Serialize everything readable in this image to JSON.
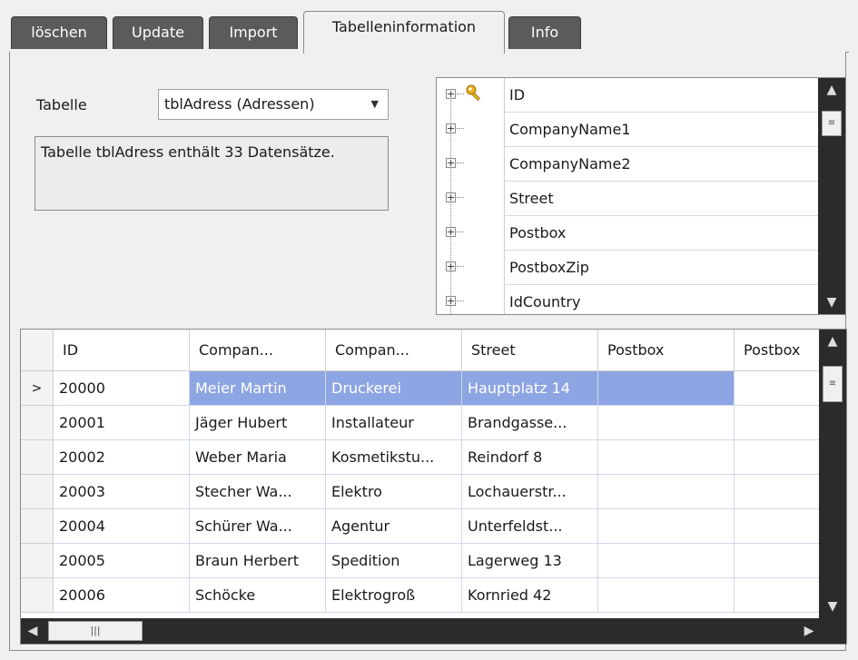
{
  "tabs": [
    {
      "label": "löschen"
    },
    {
      "label": "Update"
    },
    {
      "label": "Import"
    },
    {
      "label": "Tabelleninformation"
    },
    {
      "label": "Info"
    }
  ],
  "active_tab": "Tabelleninformation",
  "table_label": "Tabelle",
  "table_select": {
    "value": "tblAdress (Adressen)",
    "arrow_icon": "dropdown-arrow-icon"
  },
  "info_text": "Tabelle tblAdress enthält 33 Datensätze.",
  "fields": [
    {
      "name": "ID",
      "icon": "key-icon"
    },
    {
      "name": "CompanyName1"
    },
    {
      "name": "CompanyName2"
    },
    {
      "name": "Street"
    },
    {
      "name": "Postbox"
    },
    {
      "name": "PostboxZip"
    },
    {
      "name": "IdCountry"
    }
  ],
  "grid": {
    "columns": [
      "ID",
      "Compan...",
      "Compan...",
      "Street",
      "Postbox",
      "Postbox"
    ],
    "rows": [
      {
        "indicator": ">",
        "cells": [
          "20000",
          "Meier Martin",
          "Druckerei",
          "Hauptplatz 14",
          "",
          ""
        ]
      },
      {
        "indicator": "",
        "cells": [
          "20001",
          "Jäger Hubert",
          "Installateur",
          "Brandgasse...",
          "",
          ""
        ]
      },
      {
        "indicator": "",
        "cells": [
          "20002",
          "Weber Maria",
          "Kosmetikstu...",
          "Reindorf 8",
          "",
          ""
        ]
      },
      {
        "indicator": "",
        "cells": [
          "20003",
          "Stecher Wa...",
          "Elektro",
          "Lochauerstr...",
          "",
          ""
        ]
      },
      {
        "indicator": "",
        "cells": [
          "20004",
          "Schürer Wa...",
          "Agentur",
          "Unterfeldst...",
          "",
          ""
        ]
      },
      {
        "indicator": "",
        "cells": [
          "20005",
          "Braun Herbert",
          "Spedition",
          "Lagerweg 13",
          "",
          ""
        ]
      },
      {
        "indicator": "",
        "cells": [
          "20006",
          "Schöcke",
          "Elektrogroß",
          "Kornried 42",
          "",
          ""
        ]
      }
    ],
    "selected_row": 0
  },
  "colors": {
    "selection": "#8ea5e3",
    "scrollbar": "#2b2b2b",
    "tab_inactive": "#5b5b5b"
  }
}
